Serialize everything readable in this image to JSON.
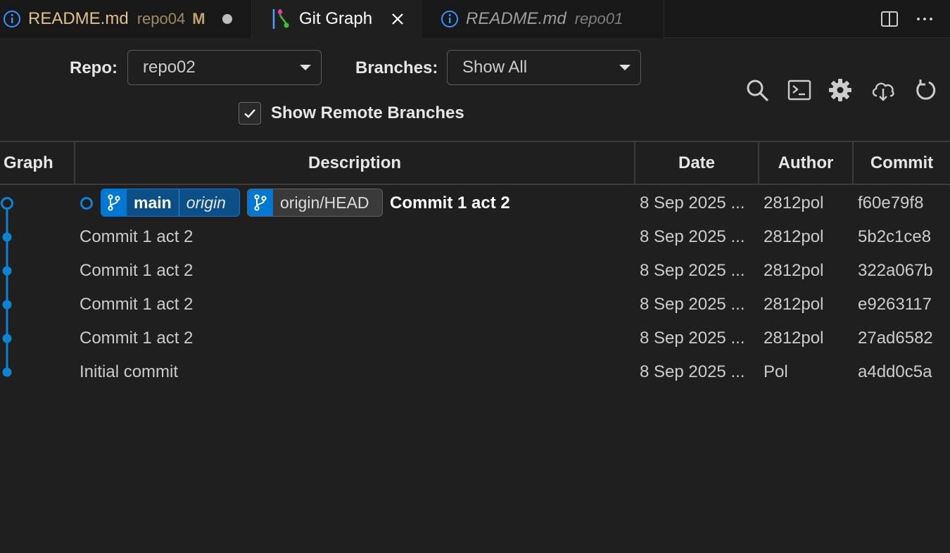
{
  "tabs": [
    {
      "label": "README.md",
      "description": "repo04",
      "status": "M"
    },
    {
      "label": "Git Graph"
    },
    {
      "label": "README.md",
      "description": "repo01"
    }
  ],
  "controls": {
    "repo_label": "Repo:",
    "repo_value": "repo02",
    "branches_label": "Branches:",
    "branches_value": "Show All",
    "remote_label": "Show Remote Branches",
    "remote_checked": true
  },
  "columns": {
    "graph": "Graph",
    "description": "Description",
    "date": "Date",
    "author": "Author",
    "commit": "Commit"
  },
  "head_refs": {
    "branch": "main",
    "remote": "origin",
    "remote_head": "origin/HEAD"
  },
  "commits": [
    {
      "message": "Commit 1 act 2",
      "date": "8 Sep 2025 ...",
      "author": "2812pol",
      "hash": "f60e79f8"
    },
    {
      "message": "Commit 1 act 2",
      "date": "8 Sep 2025 ...",
      "author": "2812pol",
      "hash": "5b2c1ce8"
    },
    {
      "message": "Commit 1 act 2",
      "date": "8 Sep 2025 ...",
      "author": "2812pol",
      "hash": "322a067b"
    },
    {
      "message": "Commit 1 act 2",
      "date": "8 Sep 2025 ...",
      "author": "2812pol",
      "hash": "e9263117"
    },
    {
      "message": "Commit 1 act 2",
      "date": "8 Sep 2025 ...",
      "author": "2812pol",
      "hash": "27ad6582"
    },
    {
      "message": "Initial commit",
      "date": "8 Sep 2025 ...",
      "author": "Pol",
      "hash": "a4dd0c5a"
    }
  ],
  "colors": {
    "graph_line": "#0a84d6",
    "accent": "#0078d4",
    "modified": "#e2c08d"
  },
  "icons": [
    "info-icon",
    "git-graph-icon",
    "close-icon",
    "split-editor-icon",
    "more-icon",
    "search-icon",
    "terminal-icon",
    "gear-icon",
    "cloud-download-icon",
    "refresh-icon",
    "branch-icon",
    "check-icon"
  ]
}
